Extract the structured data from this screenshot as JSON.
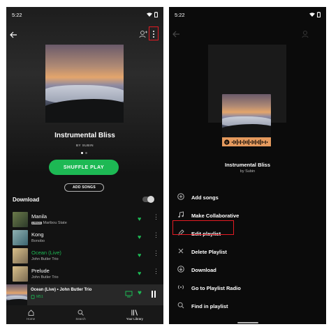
{
  "left": {
    "status_time": "5:22",
    "playlist_title": "Instrumental Bliss",
    "owner": "BY SUBIN",
    "shuffle_label": "SHUFFLE PLAY",
    "add_songs_label": "ADD SONGS",
    "download_label": "Download",
    "tracks": [
      {
        "name": "Manila",
        "artist": "Maribou State",
        "badge": "LYRICS",
        "green": false
      },
      {
        "name": "Kong",
        "artist": "Bonobo",
        "badge": "",
        "green": false
      },
      {
        "name": "Ocean (Live)",
        "artist": "John Butler Trio",
        "badge": "",
        "green": true
      },
      {
        "name": "Prelude",
        "artist": "John Butler Trio",
        "badge": "",
        "green": false
      }
    ],
    "now_playing": {
      "title": "Ocean (Live) • John Butler Trio",
      "device": "M51"
    },
    "tabs": [
      "Home",
      "Search",
      "Your Library"
    ]
  },
  "right": {
    "status_time": "5:22",
    "playlist_title": "Instrumental Bliss",
    "owner": "by Subin",
    "menu": [
      {
        "label": "Add songs",
        "icon": "plus-circle-icon"
      },
      {
        "label": "Make Collaborative",
        "icon": "music-note-icon"
      },
      {
        "label": "Edit playlist",
        "icon": "pencil-icon"
      },
      {
        "label": "Delete Playlist",
        "icon": "close-icon"
      },
      {
        "label": "Download",
        "icon": "download-icon"
      },
      {
        "label": "Go to Playlist Radio",
        "icon": "radio-icon"
      },
      {
        "label": "Find in playlist",
        "icon": "search-icon"
      }
    ]
  },
  "colors": {
    "accent": "#1db954",
    "highlight": "#e31b23",
    "background": "#121212"
  }
}
